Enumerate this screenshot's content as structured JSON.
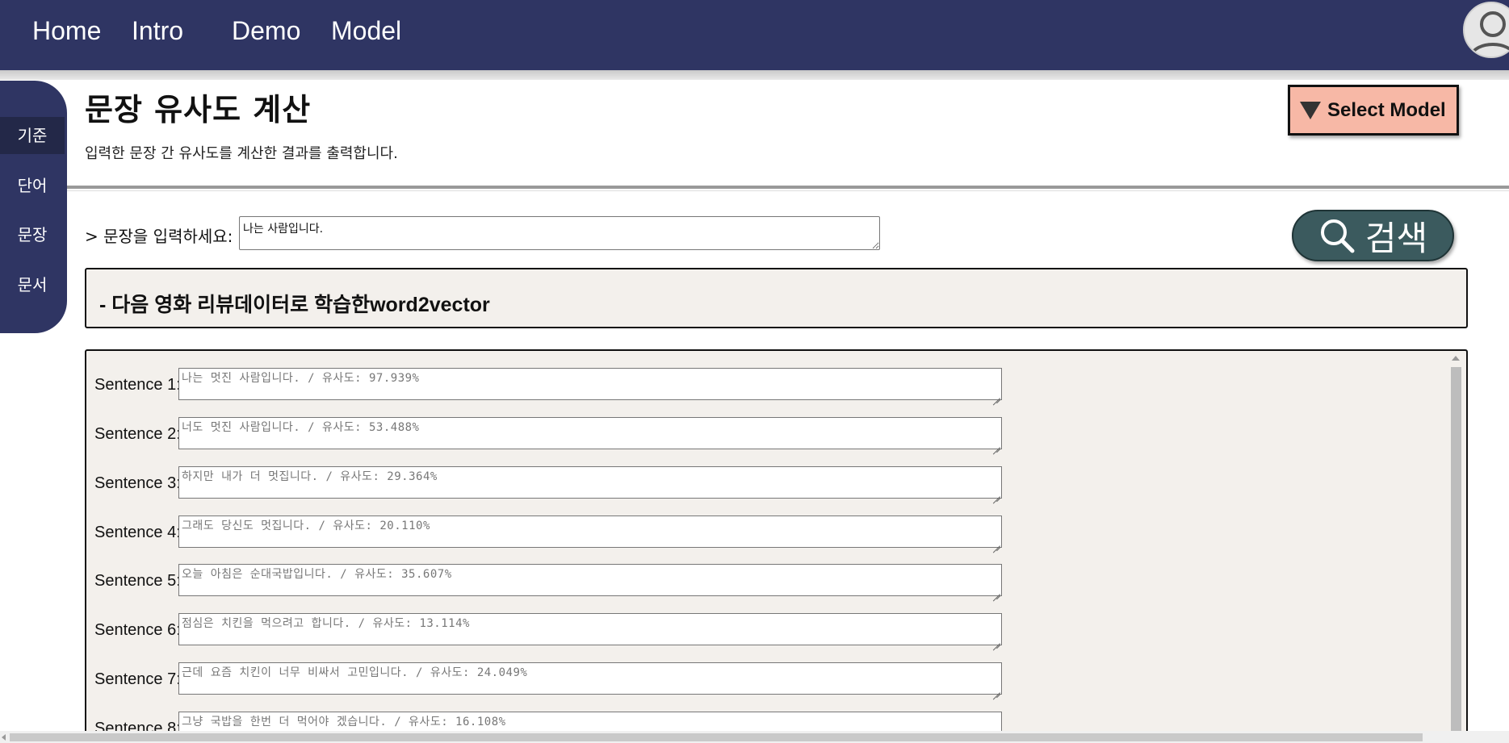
{
  "nav": {
    "items": [
      "Home",
      "Intro",
      "Demo",
      "Model"
    ]
  },
  "sidebar": {
    "items": [
      {
        "label": "기준",
        "active": true
      },
      {
        "label": "단어",
        "active": false
      },
      {
        "label": "문장",
        "active": false
      },
      {
        "label": "문서",
        "active": false
      }
    ]
  },
  "header": {
    "title": "문장 유사도 계산",
    "description": "입력한 문장 간 유사도를 계산한 결과를 출력합니다.",
    "select_model_label": "Select Model"
  },
  "input": {
    "label": "> 문장을 입력하세요:",
    "value": "나는 사람입니다."
  },
  "search": {
    "label": "검색"
  },
  "model_info": {
    "text": "- 다음 영화 리뷰데이터로 학습한word2vector"
  },
  "results": [
    {
      "label": "Sentence 1:",
      "text": "나는 멋진 사람입니다. / 유사도: 97.939%"
    },
    {
      "label": "Sentence 2:",
      "text": "너도 멋진 사람입니다. / 유사도: 53.488%"
    },
    {
      "label": "Sentence 3:",
      "text": "하지만 내가 더 멋집니다. / 유사도: 29.364%"
    },
    {
      "label": "Sentence 4:",
      "text": "그래도 당신도 멋집니다. / 유사도: 20.110%"
    },
    {
      "label": "Sentence 5:",
      "text": "오늘 아침은 순대국밥입니다. / 유사도: 35.607%"
    },
    {
      "label": "Sentence 6:",
      "text": "점심은 치킨을 먹으려고 합니다. / 유사도: 13.114%"
    },
    {
      "label": "Sentence 7:",
      "text": "근데 요즘 치킨이 너무 비싸서 고민입니다. / 유사도: 24.049%"
    },
    {
      "label": "Sentence 8:",
      "text": "그냥 국밥을 한번 더 먹어야 겠습니다. / 유사도: 16.108%"
    }
  ],
  "colors": {
    "nav_bg": "#2f3563",
    "select_model_bg": "#f7b8a6",
    "search_bg": "#3b5a5e",
    "panel_bg": "#f3f0ec"
  }
}
